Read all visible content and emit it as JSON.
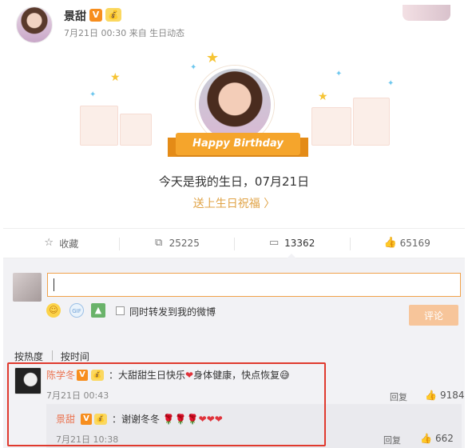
{
  "post": {
    "username": "景甜",
    "v_badge": "V",
    "member_badge": "💰",
    "meta": "7月21日 00:30 来自 生日动态"
  },
  "birthday": {
    "ribbon": "Happy Birthday",
    "message": "今天是我的生日，07月21日",
    "bless_link": "送上生日祝福 〉"
  },
  "actions": [
    {
      "icon": "star-icon",
      "label": "收藏"
    },
    {
      "icon": "repost-icon",
      "label": "25225"
    },
    {
      "icon": "comment-icon",
      "label": "13362"
    },
    {
      "icon": "thumbs-up-icon",
      "label": "65169"
    }
  ],
  "composer": {
    "placeholder": "",
    "repost_label": "同时转发到我的微博",
    "submit_label": "评论"
  },
  "sort": {
    "by_heat": "按热度",
    "by_time": "按时间"
  },
  "comment": {
    "name": "陈学冬",
    "text_before": "：大甜甜生日快乐",
    "text_after": "身体健康，快点恢复",
    "time": "7月21日 00:43",
    "reply_label": "回复",
    "likes": "9184"
  },
  "reply": {
    "name": "景甜",
    "text": "：谢谢冬冬",
    "time": "7月21日 10:38",
    "reply_label": "回复",
    "likes": "662"
  },
  "colors": {
    "accent": "#f5a52c",
    "name_link": "#eb7350",
    "highlight_border": "#e03a2e"
  }
}
